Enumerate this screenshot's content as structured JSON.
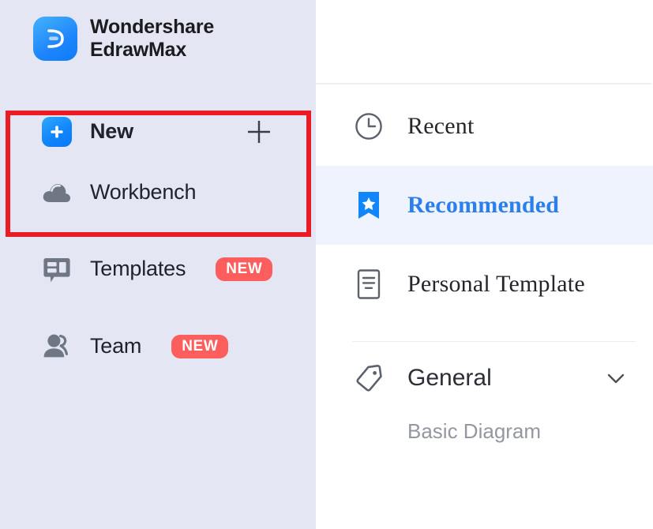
{
  "brand": {
    "line1": "Wondershare",
    "line2": "EdrawMax",
    "logo_icon": "edraw-logo-icon"
  },
  "sidebar": {
    "background_color": "#e4e6f3",
    "items": [
      {
        "label": "New",
        "icon": "plus-square-icon",
        "badge": null,
        "trailing_icon": "plus-icon",
        "highlighted": true
      },
      {
        "label": "Workbench",
        "icon": "cloud-icon",
        "badge": null,
        "trailing_icon": null,
        "highlighted": false
      },
      {
        "label": "Templates",
        "icon": "template-chat-icon",
        "badge": "NEW",
        "trailing_icon": null,
        "highlighted": false
      },
      {
        "label": "Team",
        "icon": "people-icon",
        "badge": "NEW",
        "trailing_icon": null,
        "highlighted": false
      }
    ],
    "annotation": {
      "type": "red-rectangle-highlight",
      "color": "#ec1c24",
      "target": "New"
    }
  },
  "panel": {
    "items": [
      {
        "label": "Recent",
        "icon": "clock-icon",
        "selected": false
      },
      {
        "label": "Recommended",
        "icon": "bookmark-star-icon",
        "selected": true
      },
      {
        "label": "Personal Template",
        "icon": "document-icon",
        "selected": false
      }
    ],
    "section": {
      "label": "General",
      "icon": "tag-icon",
      "chevron": "chevron-down-icon",
      "children": [
        {
          "label": "Basic Diagram"
        }
      ]
    },
    "accent_color": "#2a7fec",
    "highlight_color": "#eef3fd"
  }
}
